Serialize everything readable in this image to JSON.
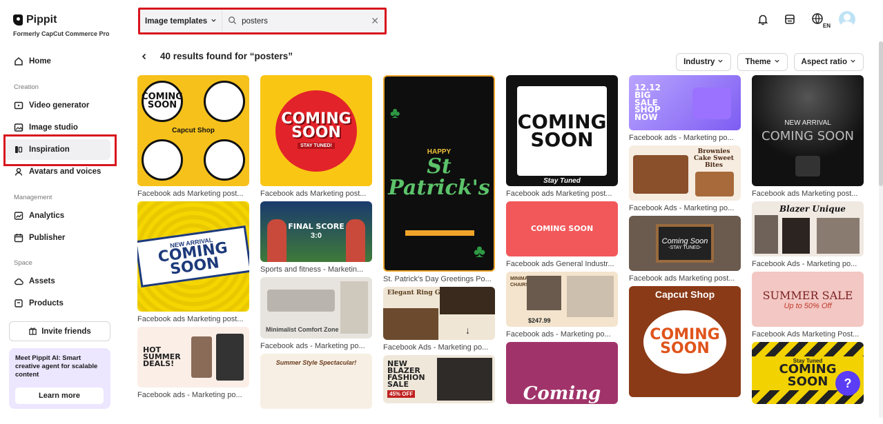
{
  "brand": {
    "name": "Pippit",
    "subtitle": "Formerly CapCut Commerce Pro"
  },
  "sidebar": {
    "home": "Home",
    "creation_label": "Creation",
    "video_generator": "Video generator",
    "image_studio": "Image studio",
    "inspiration": "Inspiration",
    "avatars": "Avatars and voices",
    "management_label": "Management",
    "analytics": "Analytics",
    "publisher": "Publisher",
    "space_label": "Space",
    "assets": "Assets",
    "products": "Products",
    "invite": "Invite friends",
    "promo_text": "Meet Pippit AI: Smart creative agent for scalable content",
    "promo_button": "Learn more"
  },
  "search": {
    "type": "Image templates",
    "query": "posters"
  },
  "topbar": {
    "lang": "EN"
  },
  "results": {
    "title": "40 results found for “posters”"
  },
  "filters": {
    "industry": "Industry",
    "theme": "Theme",
    "aspect": "Aspect ratio"
  },
  "columns": [
    [
      {
        "caption": "Facebook ads Marketing post...",
        "text": "COMING SOON",
        "sub": "Capcut Shop"
      },
      {
        "caption": "Facebook ads Marketing post...",
        "text": "COMING SOON",
        "sub": "NEW ARRIVAL"
      },
      {
        "caption": "Facebook ads - Marketing po...",
        "text": "HOT SUMMER DEALS!",
        "sub": ""
      }
    ],
    [
      {
        "caption": "Facebook ads Marketing post...",
        "text": "COMING SOON",
        "sub": "STAY TUNED!"
      },
      {
        "caption": "Sports and fitness - Marketin...",
        "text": "FINAL SCORE",
        "sub": "3:0"
      },
      {
        "caption": "Facebook ads - Marketing po...",
        "text": "Minimalist Comfort Zone",
        "sub": ""
      },
      {
        "caption": "",
        "text": "Summer Style Spectacular!",
        "sub": ""
      }
    ],
    [
      {
        "caption": "St. Patrick's Day Greetings Po...",
        "text": "St Patrick's",
        "sub": "HAPPY"
      },
      {
        "caption": "Facebook Ads - Marketing po...",
        "text": "Elegant Ring Gold",
        "sub": ""
      },
      {
        "caption": "",
        "text": "NEW BLAZER FASHION SALE",
        "sub": "45% OFF"
      }
    ],
    [
      {
        "caption": "Facebook ads Marketing post...",
        "text": "COMING SOON",
        "sub": "Stay Tuned"
      },
      {
        "caption": "Facebook ads General Industr...",
        "text": "COMING SOON",
        "sub": ""
      },
      {
        "caption": "Facebook ads - Marketing po...",
        "text": "MINIMALIST CHAIRS",
        "sub": "$247.99"
      },
      {
        "caption": "",
        "text": "Coming",
        "sub": ""
      }
    ],
    [
      {
        "caption": "Facebook ads - Marketing po...",
        "text": "12.12 BIG SALE SHOP NOW",
        "sub": ""
      },
      {
        "caption": "Facebook Ads - Marketing po...",
        "text": "Brownies Cake Sweet Bites",
        "sub": ""
      },
      {
        "caption": "Facebook ads Marketing post...",
        "text": "Coming Soon",
        "sub": "-STAY TUNED-"
      },
      {
        "caption": "",
        "text": "COMING SOON",
        "sub": "Capcut Shop"
      }
    ],
    [
      {
        "caption": "Facebook ads Marketing post...",
        "text": "COMING SOON",
        "sub": "NEW ARRIVAL"
      },
      {
        "caption": "Facebook Ads - Marketing po...",
        "text": "Blazer Unique",
        "sub": ""
      },
      {
        "caption": "Facebook Ads Marketing Post...",
        "text": "SUMMER SALE",
        "sub": "Up to 50% Off"
      },
      {
        "caption": "",
        "text": "COMING SOON",
        "sub": "Stay Tuned"
      }
    ]
  ],
  "colors": {
    "accent": "#5b3df5",
    "highlight": "#d8141c"
  }
}
